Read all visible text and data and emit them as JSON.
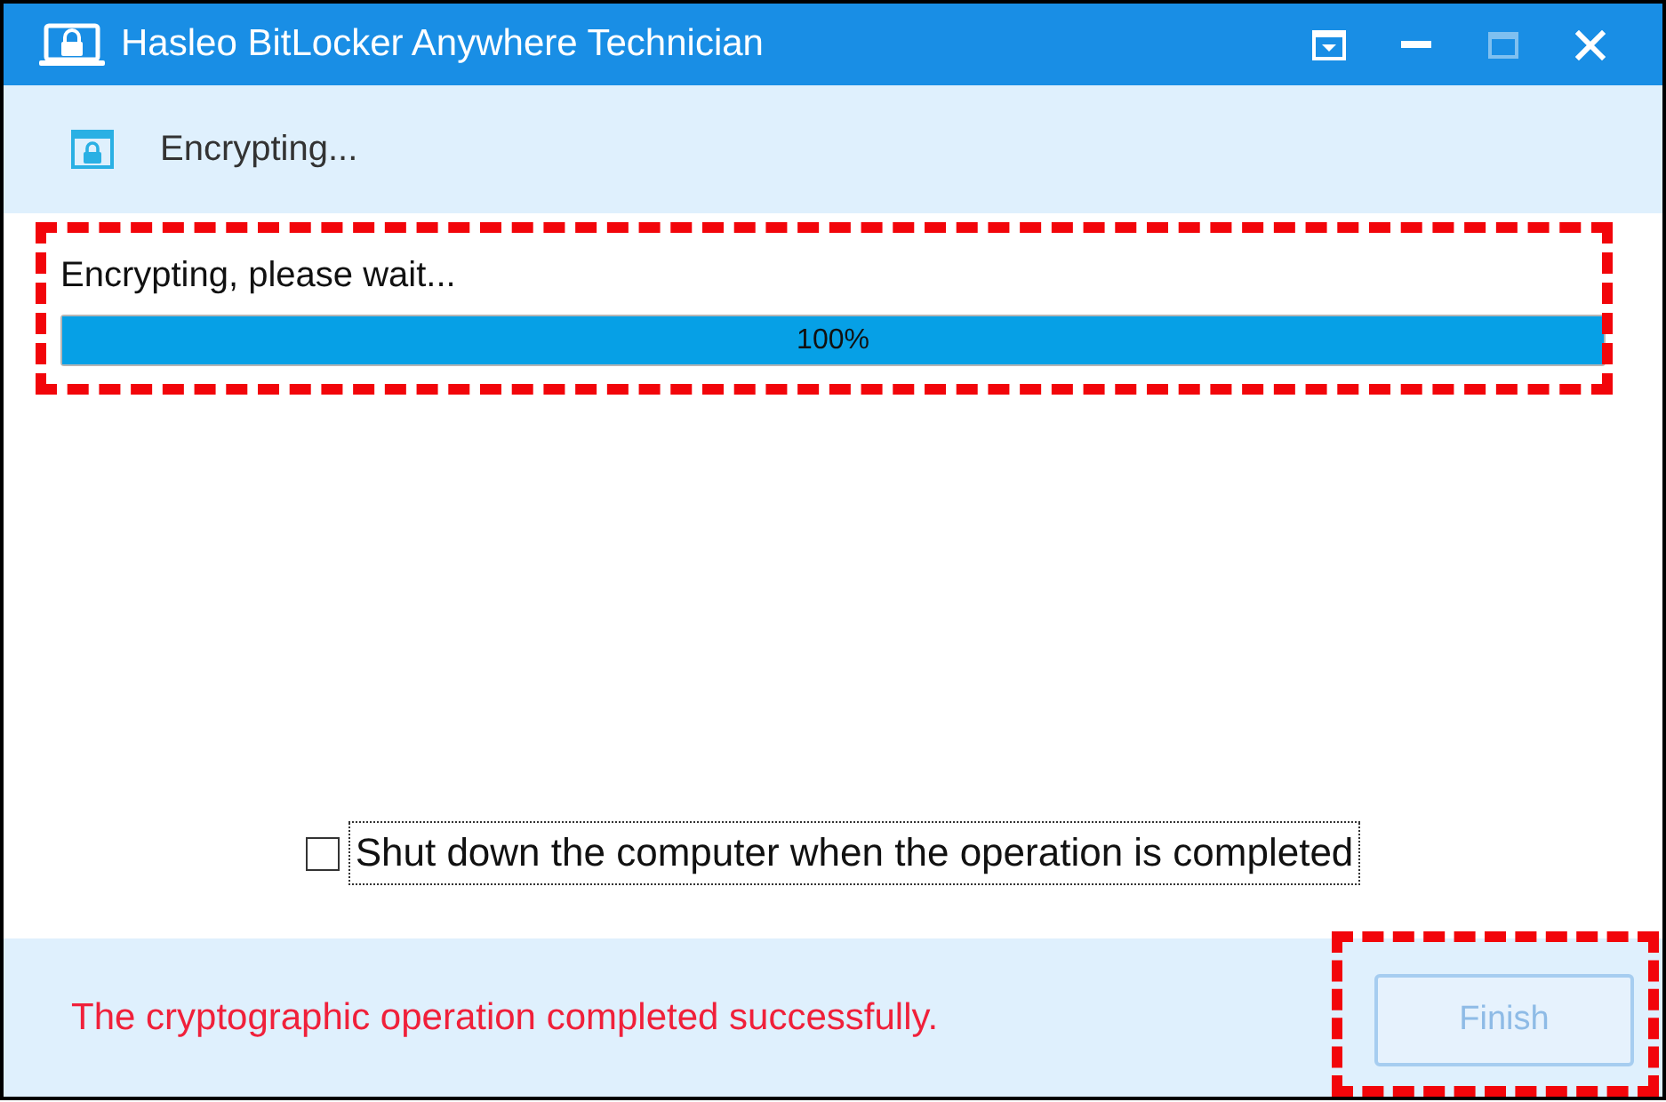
{
  "window": {
    "title": "Hasleo BitLocker Anywhere Technician",
    "controls": [
      {
        "kind": "menu",
        "disabled": false
      },
      {
        "kind": "minimize",
        "disabled": false
      },
      {
        "kind": "maximize",
        "disabled": true
      },
      {
        "kind": "close",
        "disabled": false
      }
    ]
  },
  "header": {
    "title": "Encrypting..."
  },
  "progress": {
    "label": "Encrypting, please wait...",
    "level": 1,
    "reading": "100%",
    "highlighted": true
  },
  "shutdown_option": {
    "label": "Shut down the computer when the operation is completed",
    "checked": false,
    "focused": true
  },
  "footer": {
    "message": "The cryptographic operation completed successfully.",
    "finish_button": {
      "label": "Finish",
      "disabled": true,
      "highlighted": true
    }
  }
}
